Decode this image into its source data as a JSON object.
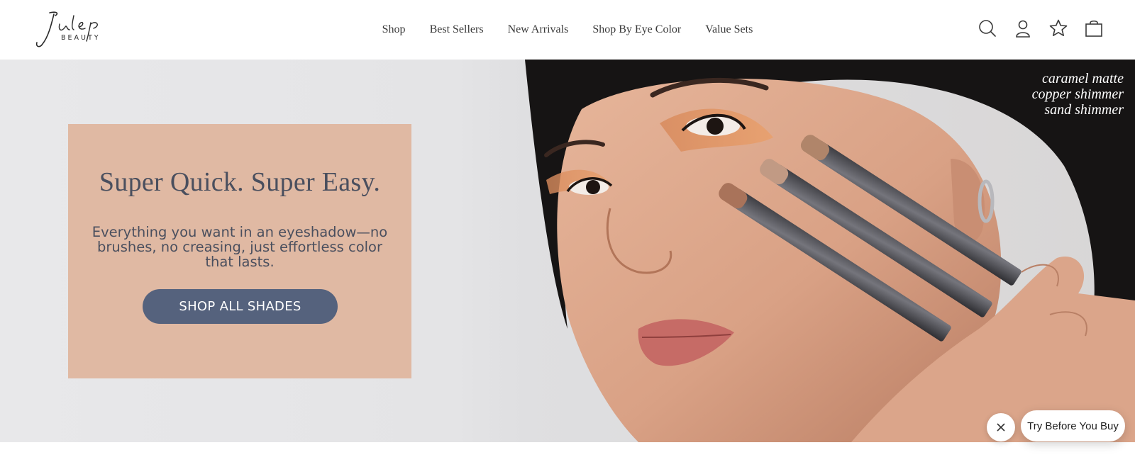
{
  "brand": {
    "logo_script": "Julep",
    "logo_sub": "BEAUTY"
  },
  "nav": {
    "items": [
      {
        "label": "Shop"
      },
      {
        "label": "Best Sellers"
      },
      {
        "label": "New Arrivals"
      },
      {
        "label": "Shop By Eye Color"
      },
      {
        "label": "Value Sets"
      }
    ]
  },
  "header_icons": [
    "search-icon",
    "account-icon",
    "star-icon",
    "bag-icon"
  ],
  "hero": {
    "caption": [
      "caramel matte",
      "copper shimmer",
      "sand shimmer"
    ],
    "title": "Super Quick. Super Easy.",
    "body": "Everything you want in an eyeshadow—no brushes, no creasing, just effortless color that lasts.",
    "cta_label": "SHOP ALL SHADES"
  },
  "widget": {
    "label": "Try Before You Buy"
  },
  "colors": {
    "promo_bg": "#e0b9a3",
    "cta_bg": "#55627d",
    "text": "#4a4f5e"
  }
}
